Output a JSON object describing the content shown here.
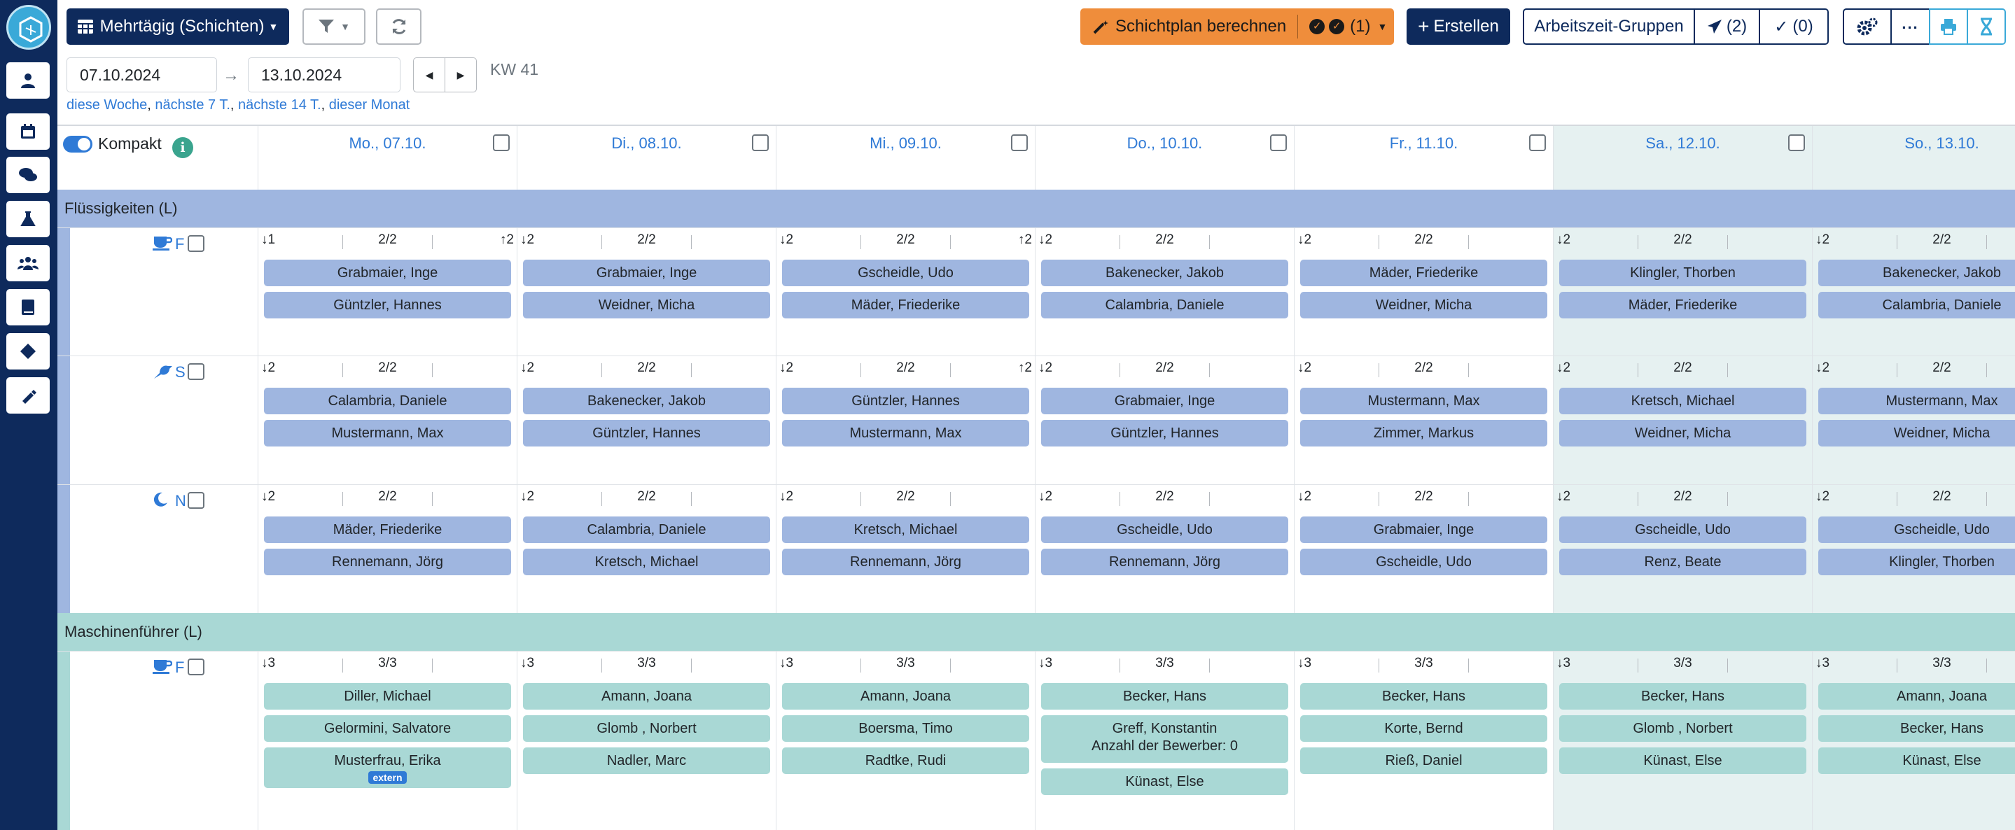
{
  "colors": {
    "navy": "#0e2a5c",
    "blue": "#2f7ad6",
    "orange": "#ef8d3b",
    "liquid_band": "#9fb6e0",
    "liquid_pill": "#9fb6e0",
    "machine_band": "#a9d8d5",
    "machine_pill": "#a9d8d5",
    "weekend": "#e6f1f1"
  },
  "toolbar": {
    "view_label": "Mehrtägig (Schichten)",
    "calc_label": "Schichtplan berechnen",
    "calc_count": "(1)",
    "create_label": "Erstellen",
    "groups_label": "Arbeitszeit-Gruppen",
    "sent_count": "(2)",
    "done_count": "(0)"
  },
  "dates": {
    "from": "07.10.2024",
    "to": "13.10.2024",
    "week": "KW 41"
  },
  "quick": [
    "diese Woche",
    "nächste 7 T.",
    "nächste 14 T.",
    "dieser Monat"
  ],
  "compact_label": "Kompakt",
  "days": [
    "Mo., 07.10.",
    "Di., 08.10.",
    "Mi., 09.10.",
    "Do., 10.10.",
    "Fr., 11.10.",
    "Sa., 12.10.",
    "So., 13.10."
  ],
  "groups": [
    {
      "name": "Flüssigkeiten (L)",
      "shifts": [
        {
          "letter": "F",
          "icon": "coffee-icon",
          "cells": [
            {
              "l": "↓1",
              "m": "2/2",
              "r": "↑2",
              "people": [
                "Grabmaier, Inge",
                "Güntzler, Hannes"
              ]
            },
            {
              "l": "↓2",
              "m": "2/2",
              "r": "",
              "people": [
                "Grabmaier, Inge",
                "Weidner, Micha"
              ]
            },
            {
              "l": "↓2",
              "m": "2/2",
              "r": "↑2",
              "people": [
                "Gscheidle, Udo",
                "Mäder, Friederike"
              ]
            },
            {
              "l": "↓2",
              "m": "2/2",
              "r": "",
              "people": [
                "Bakenecker, Jakob",
                "Calambria, Daniele"
              ]
            },
            {
              "l": "↓2",
              "m": "2/2",
              "r": "",
              "people": [
                "Mäder, Friederike",
                "Weidner, Micha"
              ]
            },
            {
              "l": "↓2",
              "m": "2/2",
              "r": "",
              "people": [
                "Klingler, Thorben",
                "Mäder, Friederike"
              ]
            },
            {
              "l": "↓2",
              "m": "2/2",
              "r": "",
              "people": [
                "Bakenecker, Jakob",
                "Calambria, Daniele"
              ]
            }
          ]
        },
        {
          "letter": "S",
          "icon": "bird-icon",
          "cells": [
            {
              "l": "↓2",
              "m": "2/2",
              "r": "",
              "people": [
                "Calambria, Daniele",
                "Mustermann, Max"
              ]
            },
            {
              "l": "↓2",
              "m": "2/2",
              "r": "",
              "people": [
                "Bakenecker, Jakob",
                "Güntzler, Hannes"
              ]
            },
            {
              "l": "↓2",
              "m": "2/2",
              "r": "↑2",
              "people": [
                "Güntzler, Hannes",
                "Mustermann, Max"
              ]
            },
            {
              "l": "↓2",
              "m": "2/2",
              "r": "",
              "people": [
                "Grabmaier, Inge",
                "Güntzler, Hannes"
              ]
            },
            {
              "l": "↓2",
              "m": "2/2",
              "r": "",
              "people": [
                "Mustermann, Max",
                "Zimmer, Markus"
              ]
            },
            {
              "l": "↓2",
              "m": "2/2",
              "r": "",
              "people": [
                "Kretsch, Michael",
                "Weidner, Micha"
              ]
            },
            {
              "l": "↓2",
              "m": "2/2",
              "r": "",
              "people": [
                "Mustermann, Max",
                "Weidner, Micha"
              ]
            }
          ]
        },
        {
          "letter": "N",
          "icon": "moon-icon",
          "cells": [
            {
              "l": "↓2",
              "m": "2/2",
              "r": "",
              "people": [
                "Mäder, Friederike",
                "Rennemann, Jörg"
              ]
            },
            {
              "l": "↓2",
              "m": "2/2",
              "r": "",
              "people": [
                "Calambria, Daniele",
                "Kretsch, Michael"
              ]
            },
            {
              "l": "↓2",
              "m": "2/2",
              "r": "",
              "people": [
                "Kretsch, Michael",
                "Rennemann, Jörg"
              ]
            },
            {
              "l": "↓2",
              "m": "2/2",
              "r": "",
              "people": [
                "Gscheidle, Udo",
                "Rennemann, Jörg"
              ]
            },
            {
              "l": "↓2",
              "m": "2/2",
              "r": "",
              "people": [
                "Grabmaier, Inge",
                "Gscheidle, Udo"
              ]
            },
            {
              "l": "↓2",
              "m": "2/2",
              "r": "",
              "people": [
                "Gscheidle, Udo",
                "Renz, Beate"
              ]
            },
            {
              "l": "↓2",
              "m": "2/2",
              "r": "",
              "people": [
                "Gscheidle, Udo",
                "Klingler, Thorben"
              ]
            }
          ]
        }
      ]
    },
    {
      "name": "Maschinenführer (L)",
      "shifts": [
        {
          "letter": "F",
          "icon": "coffee-icon",
          "cells": [
            {
              "l": "↓3",
              "m": "3/3",
              "r": "",
              "people": [
                "Diller, Michael",
                "Gelormini, Salvatore",
                "Musterfrau, Erika"
              ],
              "badge": "extern"
            },
            {
              "l": "↓3",
              "m": "3/3",
              "r": "",
              "people": [
                "Amann, Joana",
                "Glomb , Norbert",
                "Nadler, Marc"
              ]
            },
            {
              "l": "↓3",
              "m": "3/3",
              "r": "",
              "people": [
                "Amann, Joana",
                "Boersma, Timo",
                "Radtke, Rudi"
              ]
            },
            {
              "l": "↓3",
              "m": "3/3",
              "r": "",
              "people": [
                "Becker, Hans",
                "Greff, Konstantin",
                "Künast, Else"
              ],
              "note": "Anzahl der Bewerber: 0"
            },
            {
              "l": "↓3",
              "m": "3/3",
              "r": "",
              "people": [
                "Becker, Hans",
                "Korte, Bernd",
                "Rieß, Daniel"
              ]
            },
            {
              "l": "↓3",
              "m": "3/3",
              "r": "",
              "people": [
                "Becker, Hans",
                "Glomb , Norbert",
                "Künast, Else"
              ]
            },
            {
              "l": "↓3",
              "m": "3/3",
              "r": "",
              "people": [
                "Amann, Joana",
                "Becker, Hans",
                "Künast, Else"
              ]
            }
          ]
        }
      ]
    }
  ]
}
